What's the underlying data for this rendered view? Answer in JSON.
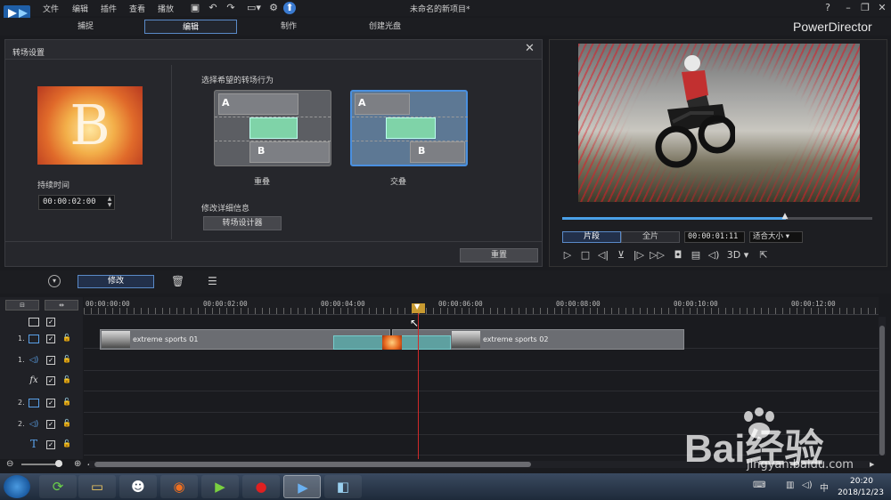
{
  "app": {
    "window_title": "未命名的新项目*",
    "brand": "PowerDirector",
    "menu": [
      "文件",
      "编辑",
      "插件",
      "查看",
      "播放"
    ],
    "mode_tabs": [
      "捕捉",
      "编辑",
      "制作",
      "创建光盘"
    ],
    "active_mode": "编辑"
  },
  "transition_panel": {
    "title": "转场设置",
    "thumbnail_letter": "B",
    "duration_label": "持续时间",
    "duration_value": "00:00:02:00",
    "behavior_label": "选择希望的转场行为",
    "options": [
      {
        "name": "重叠",
        "a": "A",
        "b": "B",
        "selected": false
      },
      {
        "name": "交叠",
        "a": "A",
        "b": "B",
        "selected": true
      }
    ],
    "details_label": "修改详细信息",
    "designer_button": "转场设计器",
    "reset_button": "重置"
  },
  "preview": {
    "tab_clip": "片段",
    "tab_movie": "全片",
    "timecode": "00:00:01:11",
    "fit_label": "适合大小",
    "progress": 0.72,
    "mode_3d": "3D"
  },
  "timeline": {
    "modify_button": "修改",
    "ruler_labels": [
      "00:00:00:00",
      "00:00:02:00",
      "00:00:04:00",
      "00:00:06:00",
      "00:00:08:00",
      "00:00:10:00",
      "00:00:12:00"
    ],
    "tracks": [
      {
        "num": "1.",
        "icon": "video-track-icon"
      },
      {
        "num": "1.",
        "icon": "audio-track-icon"
      },
      {
        "num": "",
        "icon": "fx-track-icon"
      },
      {
        "num": "2.",
        "icon": "video-track-icon"
      },
      {
        "num": "2.",
        "icon": "audio-track-icon"
      },
      {
        "num": "",
        "icon": "title-track-icon"
      }
    ],
    "fx_label": "fx",
    "title_label": "T",
    "clips": [
      {
        "label": "extreme sports 01"
      },
      {
        "label": "extreme sports 02"
      }
    ]
  },
  "taskbar": {
    "time": "20:20",
    "date": "2018/12/23"
  },
  "watermark": {
    "text": "Bai经验",
    "url": "jingyan.baidu.com"
  },
  "colors": {
    "accent": "#4a90e0",
    "playhead": "#d02a2a",
    "transition_green": "#7fd3a8"
  }
}
